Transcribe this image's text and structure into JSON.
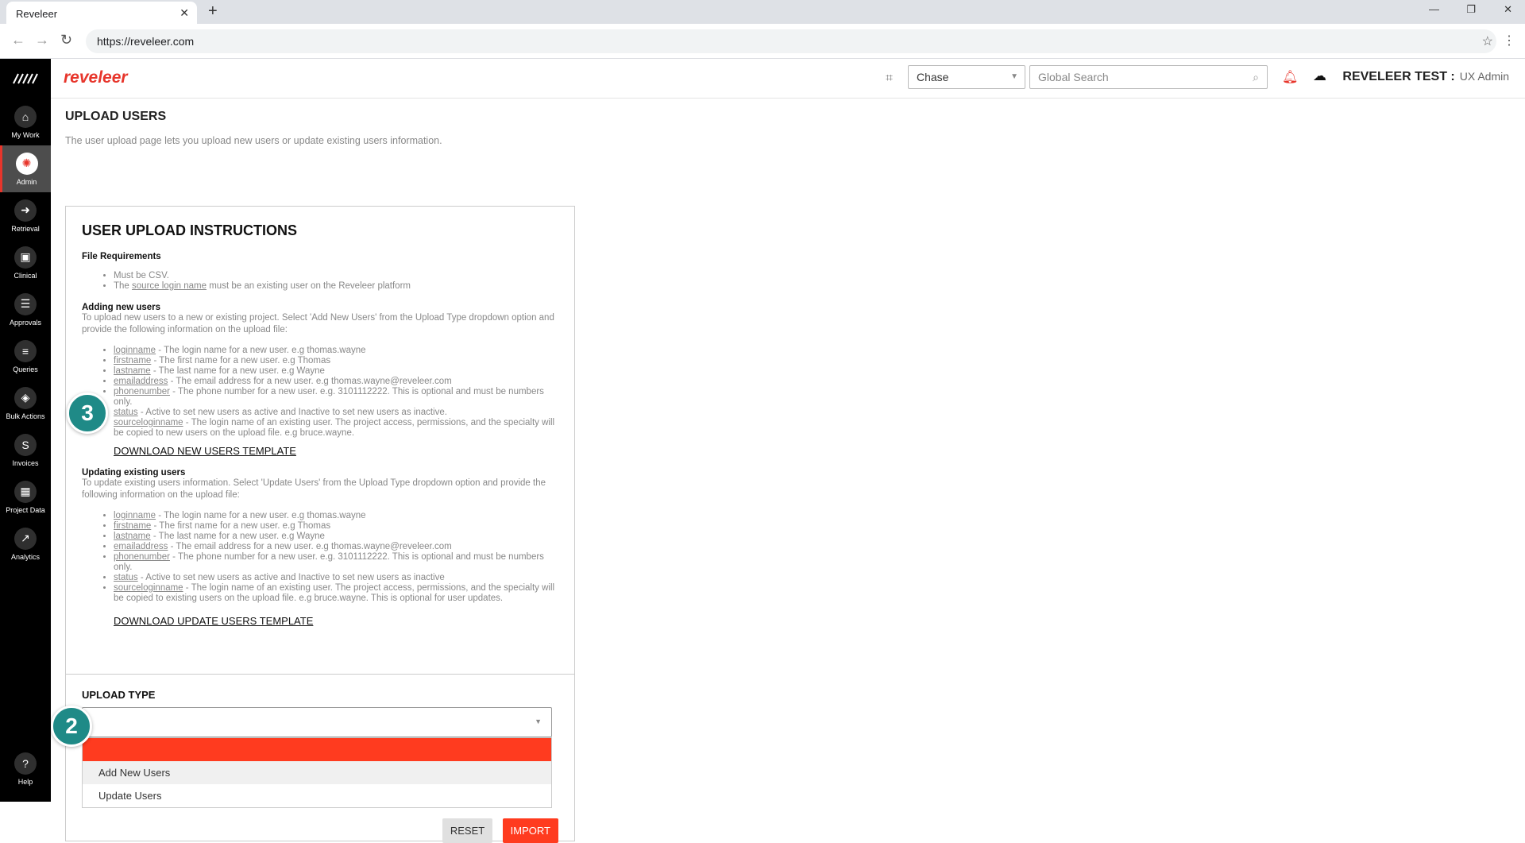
{
  "browser": {
    "tab_title": "Reveleer",
    "url": "https://reveleer.com"
  },
  "sidebar": {
    "items": [
      {
        "label": "My Work",
        "icon": "home-icon"
      },
      {
        "label": "Admin",
        "icon": "gear-icon"
      },
      {
        "label": "Retrieval",
        "icon": "arrow-right-icon"
      },
      {
        "label": "Clinical",
        "icon": "clinical-icon"
      },
      {
        "label": "Approvals",
        "icon": "list-icon"
      },
      {
        "label": "Queries",
        "icon": "queries-icon"
      },
      {
        "label": "Bulk Actions",
        "icon": "layers-icon"
      },
      {
        "label": "Invoices",
        "icon": "invoice-icon"
      },
      {
        "label": "Project Data",
        "icon": "project-data-icon"
      },
      {
        "label": "Analytics",
        "icon": "analytics-icon"
      }
    ],
    "help": "Help"
  },
  "header": {
    "brand": "reveleer",
    "chase_select": "Chase",
    "search_placeholder": "Global Search",
    "user_name": "REVELEER TEST :",
    "user_role": "UX Admin"
  },
  "page": {
    "title": "UPLOAD USERS",
    "description": "The user upload page lets you upload new users or update existing users information."
  },
  "instructions": {
    "title": "USER UPLOAD INSTRUCTIONS",
    "file_req_heading": "File Requirements",
    "file_req": {
      "csv": "Must be CSV.",
      "source_pre": "The",
      "source_term": "source login name",
      "source_post": "must be an existing user on the Reveleer platform"
    },
    "adding_heading": "Adding new users",
    "adding_desc": "To upload new users to a new or existing project. Select 'Add New Users' from the Upload Type dropdown option and provide the following information on the upload file:",
    "adding_fields": [
      {
        "term": "loginname",
        "desc": " - The login name for a new user. e.g thomas.wayne"
      },
      {
        "term": "firstname",
        "desc": " - The first name for a new user. e.g Thomas"
      },
      {
        "term": "lastname",
        "desc": " - The last name for a new user. e.g Wayne"
      },
      {
        "term": "emailaddress",
        "desc": " - The email address for a new user. e.g thomas.wayne@reveleer.com"
      },
      {
        "term": "phonenumber",
        "desc": " - The phone number for a new user. e.g. 3101112222. This is optional and must be numbers only."
      },
      {
        "term": "status",
        "desc": " - Active to set new users as active and Inactive to set new users as inactive."
      },
      {
        "term": "sourceloginname",
        "desc": " - The login name of an existing user. The project access, permissions, and the specialty will be copied to new users on the upload file. e.g bruce.wayne."
      }
    ],
    "download_new": "DOWNLOAD NEW USERS TEMPLATE",
    "updating_heading": "Updating existing users",
    "updating_desc": "To update existing users information. Select 'Update Users' from the Upload Type dropdown option and provide the following information on the upload file:",
    "updating_fields": [
      {
        "term": "loginname",
        "desc": " - The login name for a new user. e.g thomas.wayne"
      },
      {
        "term": "firstname",
        "desc": " - The first name for a new user. e.g Thomas"
      },
      {
        "term": "lastname",
        "desc": " - The last name for a new user. e.g Wayne"
      },
      {
        "term": "emailaddress",
        "desc": " - The email address for a new user. e.g thomas.wayne@reveleer.com"
      },
      {
        "term": "phonenumber",
        "desc": " - The phone number for a new user. e.g. 3101112222. This is optional and must be numbers only."
      },
      {
        "term": "status",
        "desc": " - Active to set new users as active and Inactive to set new users as inactive"
      },
      {
        "term": "sourceloginname",
        "desc": " - The login name of an existing user. The project access, permissions, and the specialty will be copied to existing users on the upload file. e.g bruce.wayne. This is optional for user updates."
      }
    ],
    "download_update": "DOWNLOAD UPDATE USERS TEMPLATE"
  },
  "upload": {
    "label": "UPLOAD TYPE",
    "selected": "",
    "options": [
      "Add New Users",
      "Update Users"
    ],
    "reset": "RESET",
    "import": "IMPORT"
  },
  "callouts": {
    "step_download": "3",
    "step_dropdown": "2"
  },
  "colors": {
    "accent": "#e7352b",
    "import_button": "#ff3b1f",
    "callout": "#1f8a87",
    "sidebar": "#000000"
  }
}
